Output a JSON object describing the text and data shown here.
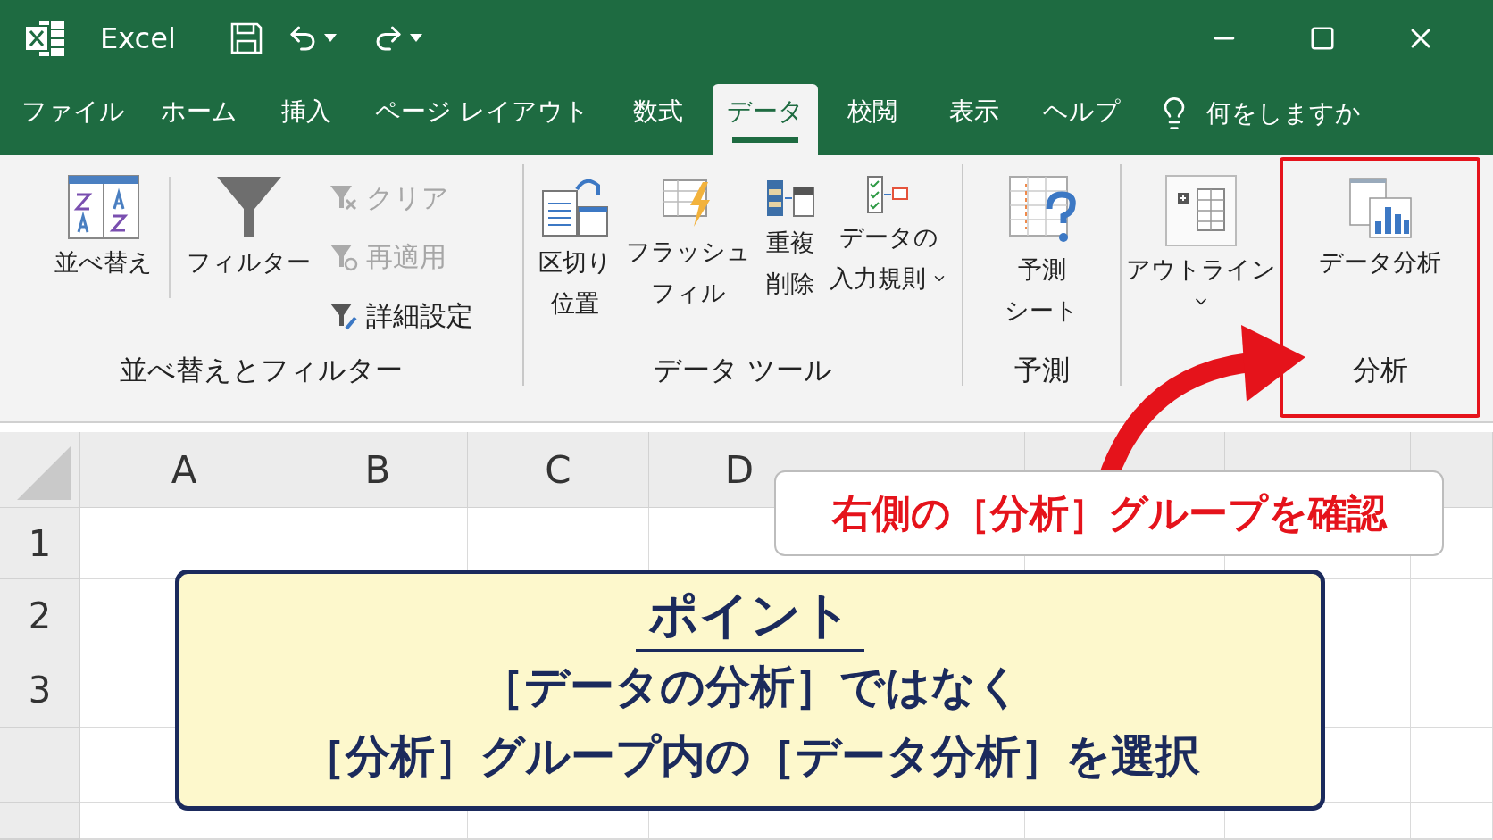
{
  "window": {
    "app_name": "Excel"
  },
  "tabs": [
    {
      "label": "ファイル",
      "selected": false
    },
    {
      "label": "ホーム",
      "selected": false
    },
    {
      "label": "挿入",
      "selected": false
    },
    {
      "label": "ページ レイアウト",
      "selected": false
    },
    {
      "label": "数式",
      "selected": false
    },
    {
      "label": "データ",
      "selected": true
    },
    {
      "label": "校閲",
      "selected": false
    },
    {
      "label": "表示",
      "selected": false
    },
    {
      "label": "ヘルプ",
      "selected": false
    }
  ],
  "tell_me": {
    "label": "何をしますか"
  },
  "ribbon": {
    "groups": [
      {
        "label": "並べ替えとフィルター",
        "buttons": [
          {
            "kind": "large",
            "lines": [
              "並べ替え"
            ],
            "dropdown": false
          },
          {
            "kind": "large",
            "lines": [
              "フィルター"
            ],
            "dropdown": false
          },
          {
            "kind": "small",
            "label": "クリア",
            "disabled": true
          },
          {
            "kind": "small",
            "label": "再適用",
            "disabled": true
          },
          {
            "kind": "small",
            "label": "詳細設定",
            "disabled": false
          }
        ]
      },
      {
        "label": "データ ツール",
        "buttons": [
          {
            "kind": "large",
            "lines": [
              "区切り",
              "位置"
            ],
            "dropdown": false
          },
          {
            "kind": "large",
            "lines": [
              "フラッシュ",
              "フィル"
            ],
            "dropdown": false
          },
          {
            "kind": "large",
            "lines": [
              "重複",
              "削除"
            ],
            "dropdown": false
          },
          {
            "kind": "large",
            "lines": [
              "データの",
              "入力規則"
            ],
            "dropdown": true
          }
        ]
      },
      {
        "label": "予測",
        "buttons": [
          {
            "kind": "large",
            "lines": [
              "予測",
              "シート"
            ],
            "dropdown": false
          }
        ]
      },
      {
        "buttons": [
          {
            "kind": "large",
            "lines": [
              "アウトライン"
            ],
            "dropdown": true
          }
        ]
      },
      {
        "label": "分析",
        "highlighted": true,
        "buttons": [
          {
            "kind": "large",
            "lines": [
              "データ分析"
            ],
            "dropdown": false
          }
        ]
      }
    ]
  },
  "sheet": {
    "columns": [
      "A",
      "B",
      "C",
      "D"
    ],
    "rows": [
      "1",
      "2",
      "3"
    ]
  },
  "callout": {
    "text": "右側の［分析］グループを確認"
  },
  "point": {
    "title": "ポイント",
    "lines": [
      "［データの分析］ではなく",
      "［分析］グループ内の［データ分析］を選択"
    ]
  }
}
